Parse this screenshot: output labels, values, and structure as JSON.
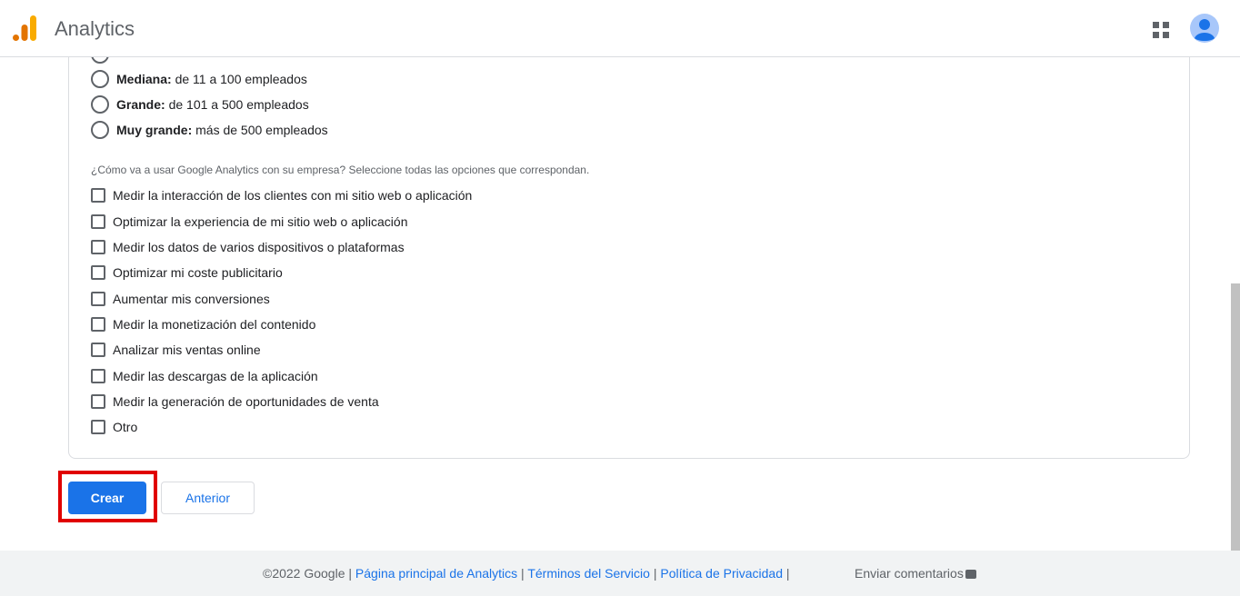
{
  "header": {
    "app_title": "Analytics",
    "brand_colors": [
      "#f9ab00",
      "#e37400"
    ]
  },
  "size_options": [
    {
      "bold": "Mediana:",
      "text": "de 11 a 100 empleados"
    },
    {
      "bold": "Grande:",
      "text": "de 101 a 500 empleados"
    },
    {
      "bold": "Muy grande:",
      "text": "más de 500 empleados"
    }
  ],
  "usage": {
    "question": "¿Cómo va a usar Google Analytics con su empresa? Seleccione todas las opciones que correspondan.",
    "options": [
      "Medir la interacción de los clientes con mi sitio web o aplicación",
      "Optimizar la experiencia de mi sitio web o aplicación",
      "Medir los datos de varios dispositivos o plataformas",
      "Optimizar mi coste publicitario",
      "Aumentar mis conversiones",
      "Medir la monetización del contenido",
      "Analizar mis ventas online",
      "Medir las descargas de la aplicación",
      "Medir la generación de oportunidades de venta",
      "Otro"
    ]
  },
  "actions": {
    "create_label": "Crear",
    "back_label": "Anterior",
    "primary_color": "#1a73e8"
  },
  "footer": {
    "copyright": "©2022 Google",
    "sep": "|",
    "link_home": "Página principal de Analytics",
    "link_terms": "Términos del Servicio",
    "link_privacy": "Política de Privacidad",
    "feedback": "Enviar comentarios"
  }
}
